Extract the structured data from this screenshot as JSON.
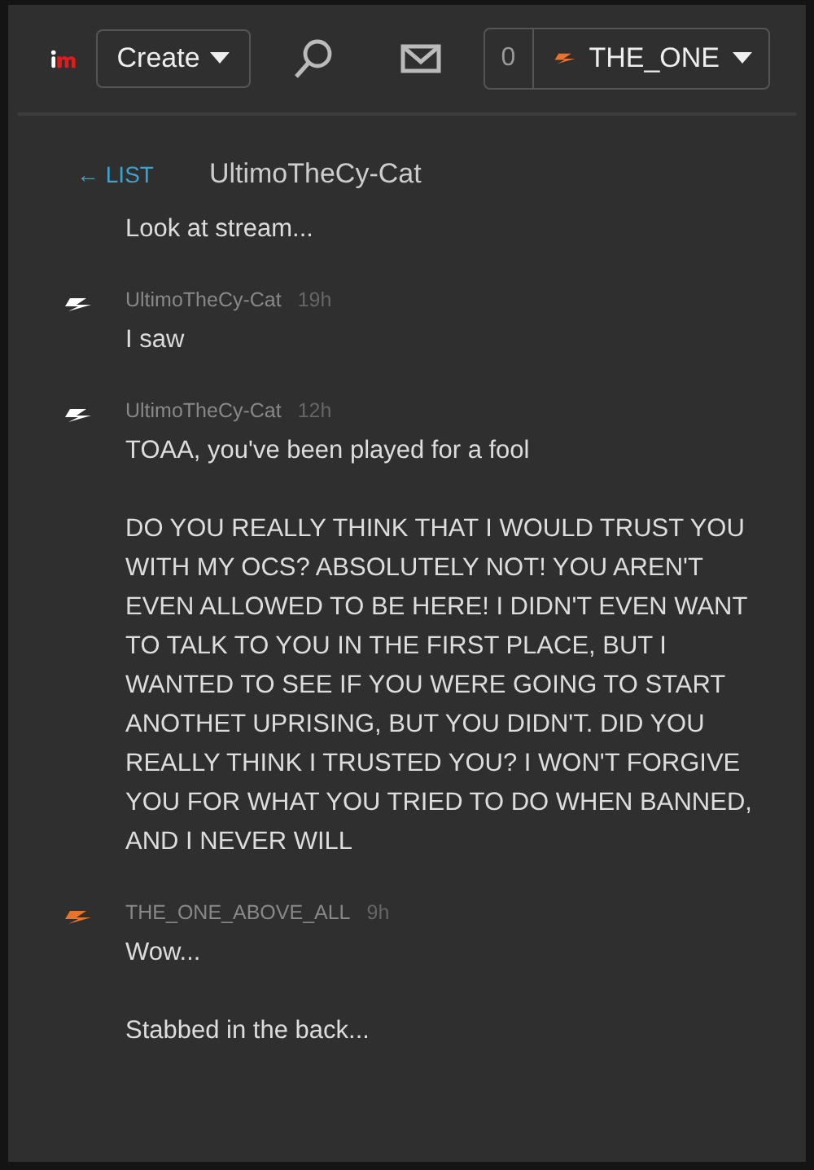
{
  "header": {
    "create_label": "Create",
    "notification_count": "0",
    "username": "THE_ONE"
  },
  "conversation": {
    "back_label": "← LIST",
    "title": "UltimoTheCy-Cat"
  },
  "messages": [
    {
      "kind": "continued",
      "paragraphs": [
        "Look at stream..."
      ]
    },
    {
      "kind": "full",
      "author": "UltimoTheCy-Cat",
      "time": "19h",
      "color": "#ffffff",
      "paragraphs": [
        "I saw"
      ]
    },
    {
      "kind": "full",
      "author": "UltimoTheCy-Cat",
      "time": "12h",
      "color": "#ffffff",
      "paragraphs": [
        "TOAA, you've been played for a fool",
        "DO YOU REALLY THINK THAT I WOULD TRUST YOU WITH MY OCS? ABSOLUTELY NOT! YOU AREN'T EVEN ALLOWED TO BE HERE! I DIDN'T EVEN WANT TO TALK TO YOU IN THE FIRST PLACE, BUT I WANTED TO SEE IF YOU WERE GOING TO START ANOTHET UPRISING, BUT YOU DIDN'T. DID YOU REALLY THINK I TRUSTED YOU? I WON'T FORGIVE YOU FOR WHAT YOU TRIED TO DO WHEN BANNED, AND I NEVER WILL"
      ]
    },
    {
      "kind": "full",
      "author": "THE_ONE_ABOVE_ALL",
      "time": "9h",
      "color": "#e8732a",
      "paragraphs": [
        "Wow...",
        "Stabbed in the back..."
      ]
    }
  ]
}
